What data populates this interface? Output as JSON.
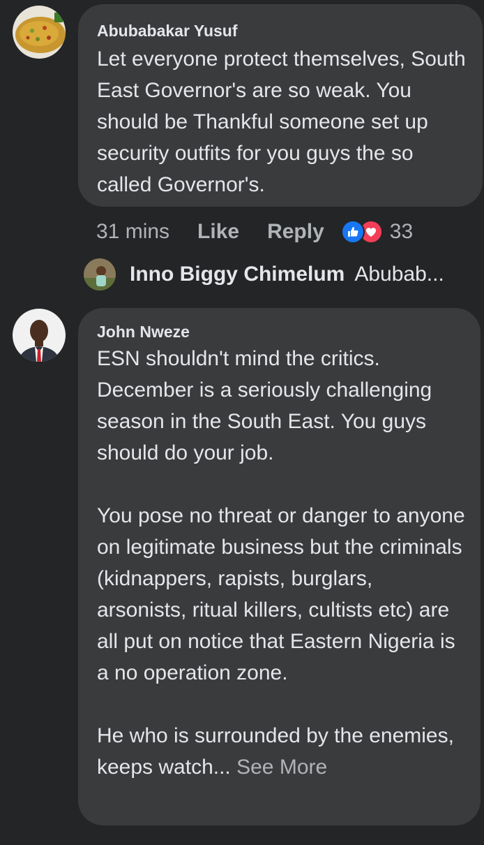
{
  "comments": [
    {
      "author": "Abubabakar Yusuf",
      "text": "Let everyone protect themselves, South East Governor's are so weak. You should be Thankful someone set up security outfits for you guys the so called Governor's.",
      "time": "31 mins",
      "like_label": "Like",
      "reply_label": "Reply",
      "reaction_count": "33",
      "reply_preview": {
        "author": "Inno Biggy Chimelum",
        "snippet": "Abubab..."
      }
    },
    {
      "author": "John Nweze",
      "text": "ESN shouldn't mind the critics. December is a seriously challenging season in the South East. You guys should do your job.\n\nYou pose no threat or danger to anyone on legitimate business but the criminals (kidnappers, rapists, burglars, arsonists, ritual killers, cultists etc) are all put on notice that Eastern Nigeria is a no operation zone.\n\nHe who is surrounded by the enemies, keeps watch...",
      "see_more_label": "See More"
    }
  ],
  "colors": {
    "background": "#242526",
    "bubble": "#3a3b3c",
    "text": "#e4e6eb",
    "secondary": "#b0b3b8",
    "like_blue": "#1877f2",
    "love_red": "#f33e58"
  }
}
